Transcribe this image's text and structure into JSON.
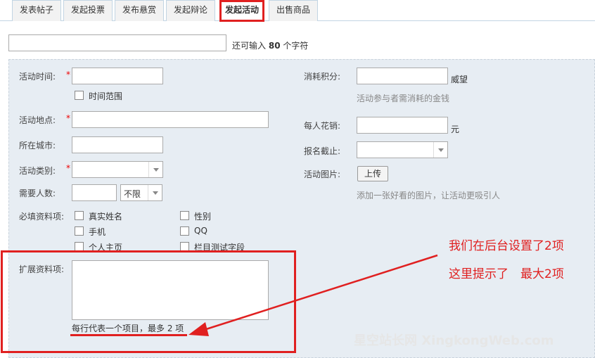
{
  "tabs": [
    "发表帖子",
    "发起投票",
    "发布悬赏",
    "发起辩论",
    "发起活动",
    "出售商品"
  ],
  "active_tab": "发起活动",
  "subject": {
    "value": "",
    "remaining_prefix": "还可输入",
    "remaining_count": "80",
    "remaining_suffix": "个字符"
  },
  "form_left": {
    "time_label": "活动时间:",
    "time_range_label": "时间范围",
    "place_label": "活动地点:",
    "city_label": "所在城市:",
    "category_label": "活动类别:",
    "category_value": "",
    "people_label": "需要人数:",
    "people_limit": "不限",
    "required_label": "必填资料项:",
    "required_items": [
      "真实姓名",
      "性别",
      "手机",
      "QQ",
      "个人主页",
      "栏目测试字段"
    ],
    "ext_label": "扩展资料项:",
    "ext_hint": "每行代表一个项目，最多 2 项",
    "required_mark": "*"
  },
  "form_right": {
    "credit_label": "消耗积分:",
    "credit_unit": "威望",
    "credit_hint": "活动参与者需消耗的金钱",
    "cost_label": "每人花销:",
    "cost_unit": "元",
    "deadline_label": "报名截止:",
    "image_label": "活动图片:",
    "upload_button": "上传",
    "image_hint": "添加一张好看的图片，让活动更吸引人"
  },
  "annotation": {
    "line1": "我们在后台设置了2项",
    "line2": "这里提示了　最大2项",
    "color": "#e02020"
  },
  "watermark": "星空站长网 XingkongWeb.com"
}
